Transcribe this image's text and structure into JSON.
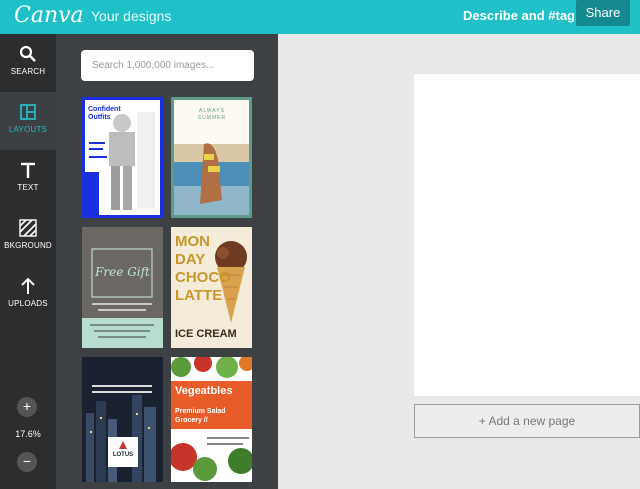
{
  "topbar": {
    "logo": "Canva",
    "nav_label": "Your designs",
    "describe_label": "Describe and #tag",
    "share_label": "Share"
  },
  "sidebar": {
    "items": [
      {
        "label": "SEARCH",
        "icon": "search-icon"
      },
      {
        "label": "LAYOUTS",
        "icon": "layouts-icon",
        "active": true
      },
      {
        "label": "TEXT",
        "icon": "text-icon"
      },
      {
        "label": "BKGROUND",
        "icon": "background-icon"
      },
      {
        "label": "UPLOADS",
        "icon": "upload-arrow-icon"
      }
    ],
    "zoom_in": "+",
    "zoom_level": "17.6%",
    "zoom_out": "−"
  },
  "panel": {
    "search_placeholder": "Search 1,000,000 images...",
    "layouts": [
      {
        "title": "Confident Outfits"
      },
      {
        "title": "ALWAYS SUMMER"
      },
      {
        "title": "Free Gift"
      },
      {
        "title": "MON DAY CHOCO LATTE",
        "subtitle": "ICE CREAM"
      },
      {
        "title": "LOTUS"
      },
      {
        "title": "Vegeatbles",
        "subtitle": "Premium Salad Grocery //"
      }
    ]
  },
  "canvas": {
    "add_page_label": "+ Add a new page"
  },
  "colors": {
    "topbar": "#1fc0c8",
    "share": "#14898f",
    "sidebar": "#2b2d2f",
    "panel": "#3e4144",
    "accent": "#27b8c8"
  }
}
